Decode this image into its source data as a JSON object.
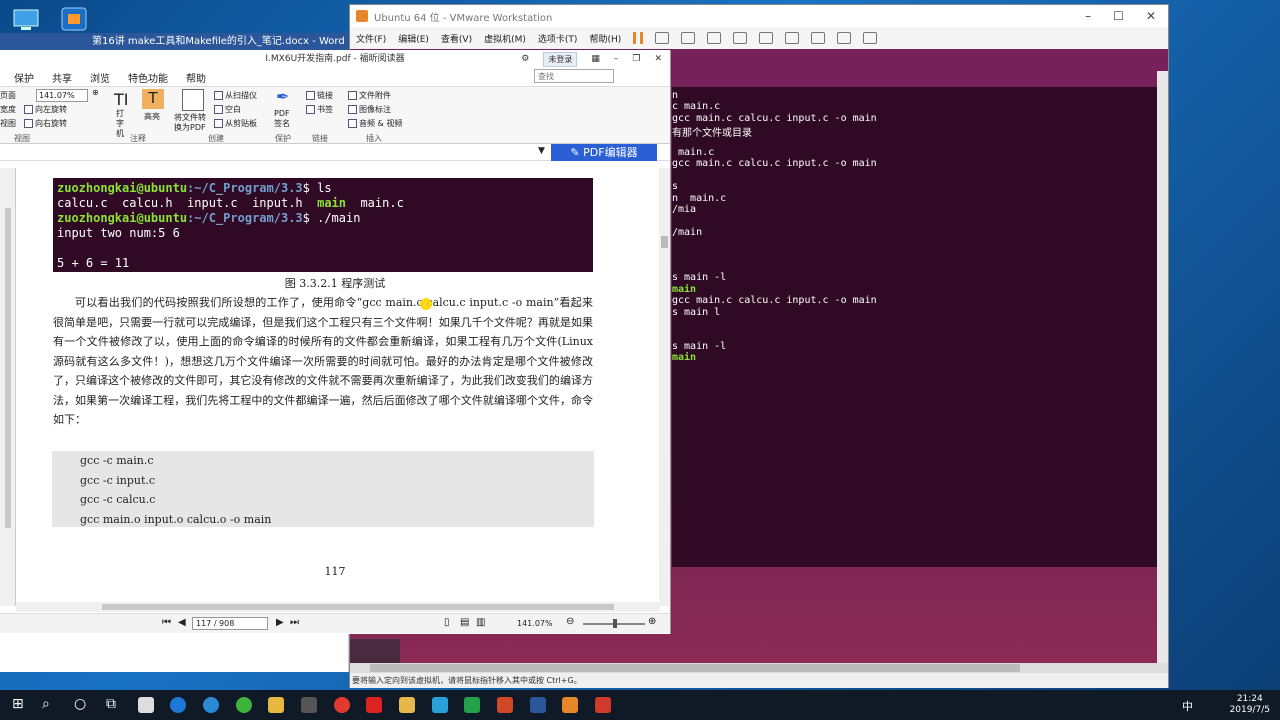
{
  "word_window": {
    "title": "第16讲 make工具和Makefile的引入_笔记.docx - Word"
  },
  "vmware": {
    "title": "Ubuntu 64 位 - VMware Workstation",
    "menu": [
      "文件(F)",
      "编辑(E)",
      "查看(V)",
      "虚拟机(M)",
      "选项卡(T)",
      "帮助(H)"
    ],
    "status_text": "要将输入定向到该虚拟机，请将鼠标指针移入其中或按 Ctrl+G。",
    "terminal_lines": [
      {
        "text": "n",
        "green": false
      },
      {
        "text": "c main.c",
        "green": false
      },
      {
        "text": "gcc main.c calcu.c input.c -o main",
        "green": false
      },
      {
        "text": "有那个文件或目录",
        "green": false
      },
      {
        "text": "",
        "green": false
      },
      {
        "text": " main.c",
        "green": false
      },
      {
        "text": "gcc main.c calcu.c input.c -o main",
        "green": false
      },
      {
        "text": "",
        "green": false
      },
      {
        "text": "s",
        "green": false
      },
      {
        "text": "n  main.c",
        "green": false
      },
      {
        "text": "/mia",
        "green": false
      },
      {
        "text": "",
        "green": false
      },
      {
        "text": "/main",
        "green": false
      },
      {
        "text": "",
        "green": false
      },
      {
        "text": "",
        "green": false
      },
      {
        "text": "",
        "green": false
      },
      {
        "text": "s main -l",
        "green": false
      },
      {
        "text": "main",
        "green": true
      },
      {
        "text": "gcc main.c calcu.c input.c -o main",
        "green": false
      },
      {
        "text": "s main l",
        "green": false
      },
      {
        "text": "",
        "green": false
      },
      {
        "text": "",
        "green": false
      },
      {
        "text": "s main -l",
        "green": false
      },
      {
        "text": "main",
        "green": true
      }
    ]
  },
  "foxit": {
    "title": "I.MX6U开发指南.pdf - 福昕阅读器",
    "login_label": "未登录",
    "search_placeholder": "查找",
    "tabs": [
      "保护",
      "共享",
      "浏览",
      "特色功能",
      "帮助"
    ],
    "ribbon": {
      "left_items": [
        "页面",
        "宽度",
        "视图"
      ],
      "zoom_value": "141.07%",
      "rotate_left": "向左旋转",
      "rotate_right": "向右旋转",
      "view_group": "视图",
      "typewriter": "打字机",
      "highlight": "高亮",
      "comment_group": "注释",
      "convert_pdf": "将文件转换为PDF",
      "from_scanner": "从扫描仪",
      "blank": "空白",
      "from_clipboard": "从剪贴板",
      "create_group": "创建",
      "pdf_sign": "PDF签名",
      "protect_group": "保护",
      "link": "链接",
      "bookmark": "书签",
      "link_group": "链接",
      "file_attach": "文件附件",
      "image_annot": "图像标注",
      "audio_video": "音频 & 视频",
      "insert_group": "插入"
    },
    "pdf_editor_label": "PDF编辑器",
    "doc": {
      "shot_lines": [
        {
          "user": "zuozhongkai@ubuntu",
          "path": ":~/C_Program/3.3",
          "cmd": "$ ls"
        },
        {
          "plain": "calcu.c  calcu.h  input.c  input.h  ",
          "green": "main",
          "tail": "  main.c"
        },
        {
          "user": "zuozhongkai@ubuntu",
          "path": ":~/C_Program/3.3",
          "cmd": "$ ./main"
        },
        {
          "plain": "input two num:5 6"
        },
        {
          "plain": ""
        },
        {
          "plain": "5 + 6 = 11"
        }
      ],
      "caption": "图 3.3.2.1  程序测试",
      "paragraph": "可以看出我们的代码按照我们所设想的工作了，使用命令“gcc main.c calcu.c input.c -o main”看起来很简单是吧，只需要一行就可以完成编译，但是我们这个工程只有三个文件啊！如果几千个文件呢？再就是如果有一个文件被修改了以，使用上面的命令编译的时候所有的文件都会重新编译，如果工程有几万个文件(Linux 源码就有这么多文件！)，想想这几万个文件编译一次所需要的时间就可怕。最好的办法肯定是哪个文件被修改了，只编译这个被修改的文件即可，其它没有修改的文件就不需要再次重新编译了，为此我们改变我们的编译方法，如果第一次编译工程，我们先将工程中的文件都编译一遍，然后后面修改了哪个文件就编译哪个文件，命令如下：",
      "code": [
        "gcc -c main.c",
        "gcc -c input.c",
        "gcc -c calcu.c",
        "gcc main.o input.o calcu.o -o main"
      ],
      "page_number": "117"
    },
    "status": {
      "page_box": "117 / 908",
      "zoom": "141.07%"
    }
  },
  "taskbar": {
    "time": "21:24",
    "date": "2019/7/5",
    "ime": "中"
  }
}
